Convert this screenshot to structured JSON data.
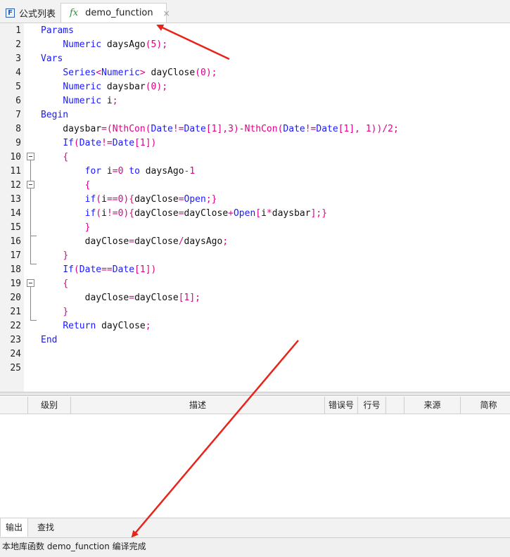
{
  "tabs": {
    "formula_list": {
      "icon": "formula-list-icon",
      "label": "公式列表"
    },
    "active": {
      "icon": "fx-icon",
      "label": "demo_function",
      "close": "×"
    }
  },
  "editor": {
    "line_numbers": [
      "1",
      "2",
      "3",
      "4",
      "5",
      "6",
      "7",
      "8",
      "9",
      "10",
      "11",
      "12",
      "13",
      "14",
      "15",
      "16",
      "17",
      "18",
      "19",
      "20",
      "21",
      "22",
      "23",
      "24",
      "25"
    ],
    "lines": [
      [
        [
          "kw",
          "Params"
        ]
      ],
      [
        [
          "id",
          "    "
        ],
        [
          "kw",
          "Numeric"
        ],
        [
          "id",
          " daysAgo"
        ],
        [
          "op",
          "(5);"
        ]
      ],
      [
        [
          "kw",
          "Vars"
        ]
      ],
      [
        [
          "id",
          "    "
        ],
        [
          "kw",
          "Series"
        ],
        [
          "op",
          "<"
        ],
        [
          "kw",
          "Numeric"
        ],
        [
          "op",
          ">"
        ],
        [
          "id",
          " dayClose"
        ],
        [
          "op",
          "(0);"
        ]
      ],
      [
        [
          "id",
          "    "
        ],
        [
          "kw",
          "Numeric"
        ],
        [
          "id",
          " daysbar"
        ],
        [
          "op",
          "(0);"
        ]
      ],
      [
        [
          "id",
          "    "
        ],
        [
          "kw",
          "Numeric"
        ],
        [
          "id",
          " i"
        ],
        [
          "op",
          ";"
        ]
      ],
      [
        [
          "kw",
          "Begin"
        ]
      ],
      [
        [
          "id",
          "    daysbar"
        ],
        [
          "op",
          "=("
        ],
        [
          "op",
          "NthCon"
        ],
        [
          "op",
          "("
        ],
        [
          "kw",
          "Date"
        ],
        [
          "op",
          "!="
        ],
        [
          "kw",
          "Date"
        ],
        [
          "op",
          "[1],3)-"
        ],
        [
          "op",
          "NthCon"
        ],
        [
          "op",
          "("
        ],
        [
          "kw",
          "Date"
        ],
        [
          "op",
          "!="
        ],
        [
          "kw",
          "Date"
        ],
        [
          "op",
          "[1], 1))/2;"
        ]
      ],
      [
        [
          "id",
          "    "
        ],
        [
          "kw",
          "If"
        ],
        [
          "op",
          "("
        ],
        [
          "kw",
          "Date"
        ],
        [
          "op",
          "!="
        ],
        [
          "kw",
          "Date"
        ],
        [
          "op",
          "[1])"
        ]
      ],
      [
        [
          "id",
          "    "
        ],
        [
          "op",
          "{"
        ]
      ],
      [
        [
          "id",
          "        "
        ],
        [
          "kw",
          "for"
        ],
        [
          "id",
          " i"
        ],
        [
          "op",
          "=0 "
        ],
        [
          "kw",
          "to"
        ],
        [
          "id",
          " daysAgo"
        ],
        [
          "op",
          "-1"
        ]
      ],
      [
        [
          "id",
          "        "
        ],
        [
          "op",
          "{"
        ]
      ],
      [
        [
          "id",
          "        "
        ],
        [
          "kw",
          "if"
        ],
        [
          "op",
          "("
        ],
        [
          "id",
          "i"
        ],
        [
          "op",
          "==0){"
        ],
        [
          "id",
          "dayClose"
        ],
        [
          "op",
          "="
        ],
        [
          "kw",
          "Open"
        ],
        [
          "op",
          ";}"
        ]
      ],
      [
        [
          "id",
          "        "
        ],
        [
          "kw",
          "if"
        ],
        [
          "op",
          "("
        ],
        [
          "id",
          "i"
        ],
        [
          "op",
          "!=0){"
        ],
        [
          "id",
          "dayClose"
        ],
        [
          "op",
          "="
        ],
        [
          "id",
          "dayClose"
        ],
        [
          "op",
          "+"
        ],
        [
          "kw",
          "Open"
        ],
        [
          "op",
          "["
        ],
        [
          "id",
          "i"
        ],
        [
          "op",
          "*"
        ],
        [
          "id",
          "daysbar"
        ],
        [
          "op",
          "];}"
        ]
      ],
      [
        [
          "id",
          "        "
        ],
        [
          "op",
          "}"
        ]
      ],
      [
        [
          "id",
          "        dayClose"
        ],
        [
          "op",
          "="
        ],
        [
          "id",
          "dayClose"
        ],
        [
          "op",
          "/"
        ],
        [
          "id",
          "daysAgo"
        ],
        [
          "op",
          ";"
        ]
      ],
      [
        [
          "id",
          "    "
        ],
        [
          "op",
          "}"
        ]
      ],
      [
        [
          "id",
          "    "
        ],
        [
          "kw",
          "If"
        ],
        [
          "op",
          "("
        ],
        [
          "kw",
          "Date"
        ],
        [
          "op",
          "=="
        ],
        [
          "kw",
          "Date"
        ],
        [
          "op",
          "[1])"
        ]
      ],
      [
        [
          "id",
          "    "
        ],
        [
          "op",
          "{"
        ]
      ],
      [
        [
          "id",
          "        dayClose"
        ],
        [
          "op",
          "="
        ],
        [
          "id",
          "dayClose"
        ],
        [
          "op",
          "[1];"
        ]
      ],
      [
        [
          "id",
          "    "
        ],
        [
          "op",
          "}"
        ]
      ],
      [
        [
          "id",
          "    "
        ],
        [
          "kw",
          "Return"
        ],
        [
          "id",
          " dayClose"
        ],
        [
          "op",
          ";"
        ]
      ],
      [
        [
          "kw",
          "End"
        ]
      ],
      [],
      []
    ]
  },
  "grid": {
    "columns": [
      "",
      "级别",
      "描述",
      "错误号",
      "行号",
      "",
      "来源",
      "简称"
    ]
  },
  "bottom_tabs": [
    "输出",
    "查找"
  ],
  "status_text": "本地库函数 demo_function 编译完成",
  "colors": {
    "keyword": "#1a1aff",
    "operator": "#e0008a",
    "arrow": "#e8231a"
  }
}
